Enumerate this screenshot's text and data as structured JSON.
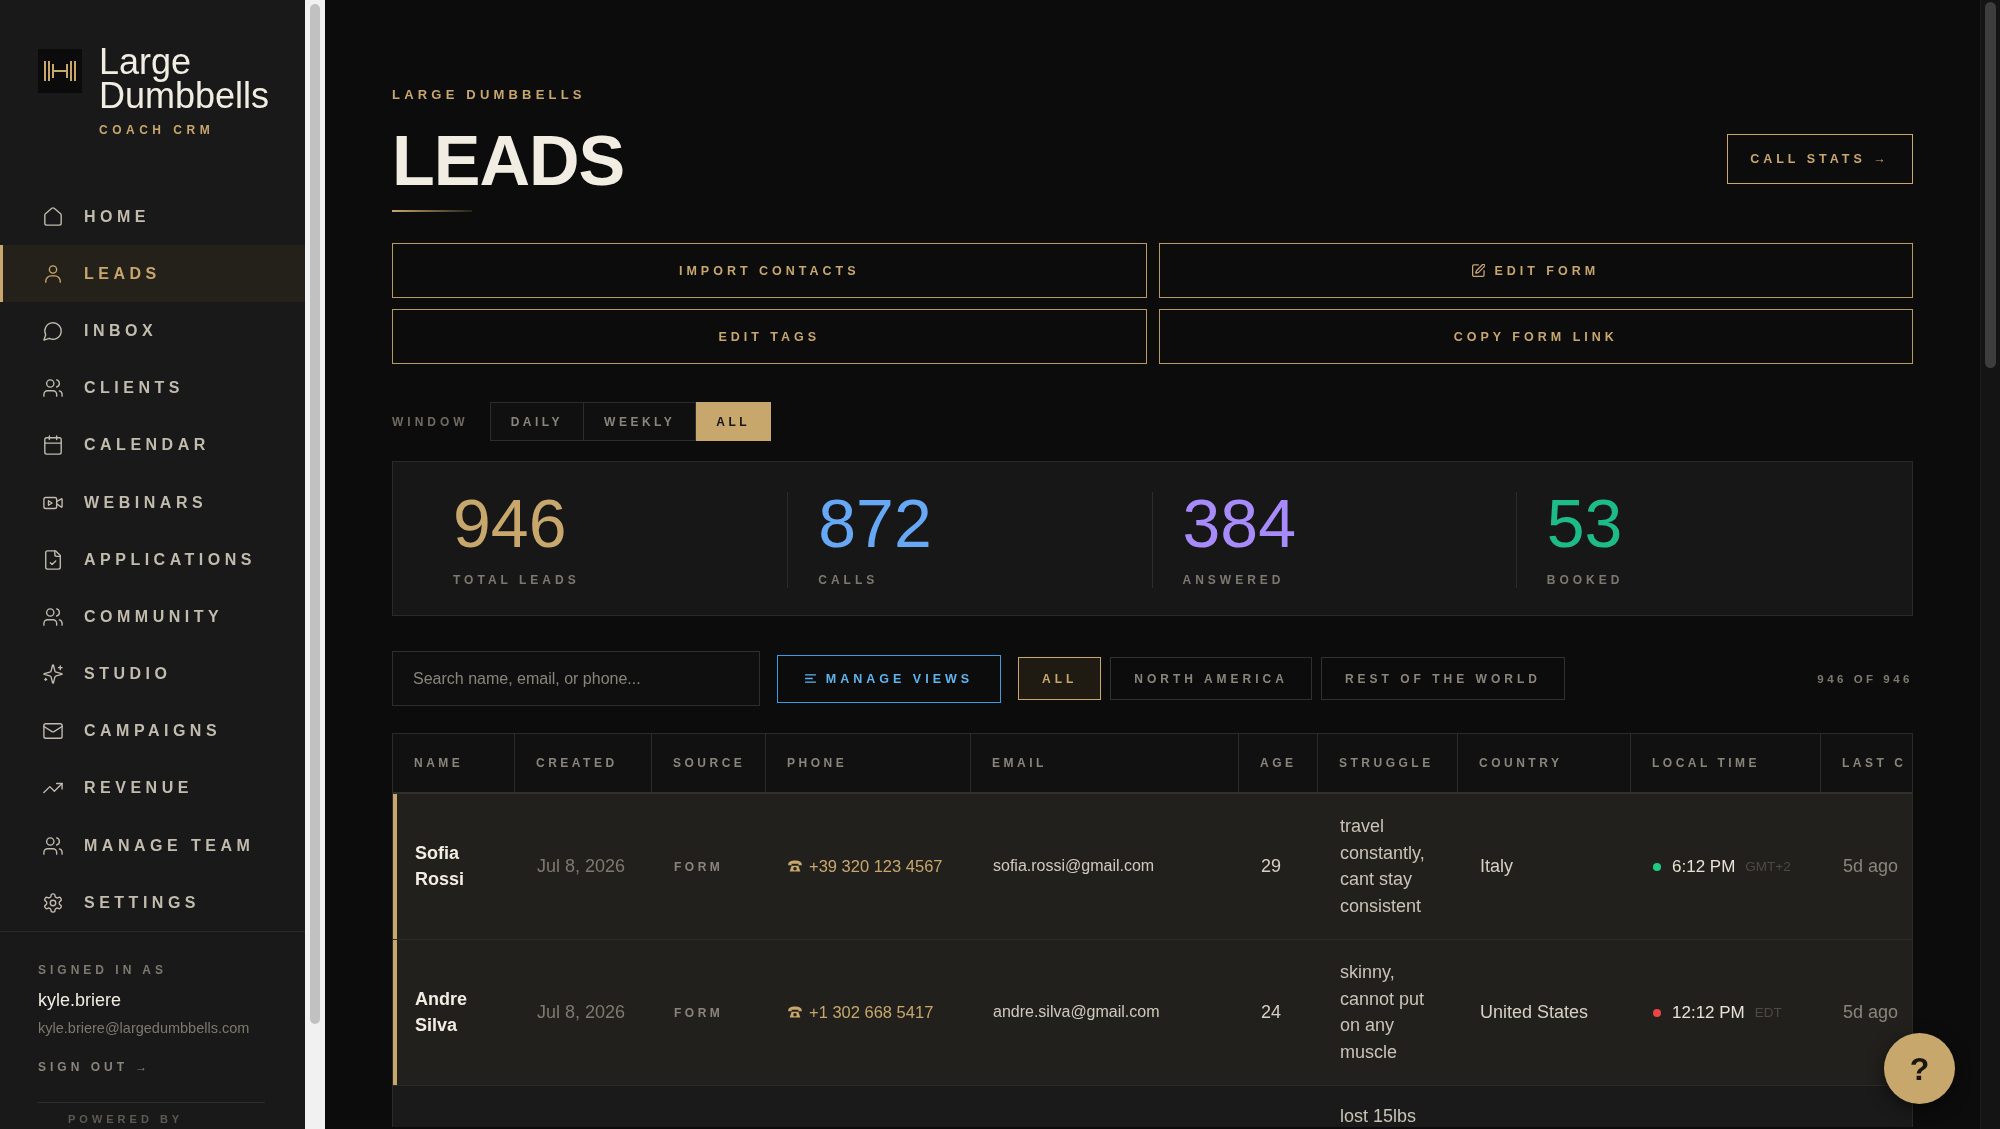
{
  "sidebar": {
    "brand": {
      "name": "Large Dumbbells",
      "tagline": "COACH CRM"
    },
    "nav": [
      {
        "label": "HOME",
        "selected": false
      },
      {
        "label": "LEADS",
        "selected": true
      },
      {
        "label": "INBOX",
        "selected": false
      },
      {
        "label": "CLIENTS",
        "selected": false
      },
      {
        "label": "CALENDAR",
        "selected": false
      },
      {
        "label": "WEBINARS",
        "selected": false
      },
      {
        "label": "APPLICATIONS",
        "selected": false
      },
      {
        "label": "COMMUNITY",
        "selected": false
      },
      {
        "label": "STUDIO",
        "selected": false
      },
      {
        "label": "CAMPAIGNS",
        "selected": false
      },
      {
        "label": "REVENUE",
        "selected": false
      },
      {
        "label": "MANAGE TEAM",
        "selected": false
      },
      {
        "label": "SETTINGS",
        "selected": false
      }
    ],
    "account": {
      "heading": "SIGNED IN AS",
      "username": "kyle.briere",
      "email": "kyle.briere@largedumbbells.com",
      "sign_out": "SIGN OUT →"
    },
    "footer": "POWERED BY"
  },
  "header": {
    "eyebrow": "LARGE DUMBBELLS",
    "title": "LEADS",
    "action": "CALL STATS →"
  },
  "actions": [
    {
      "label": "IMPORT CONTACTS",
      "kind": "plain"
    },
    {
      "label": "EDIT FORM",
      "kind": "icon"
    },
    {
      "label": "EDIT TAGS",
      "kind": "plain"
    },
    {
      "label": "COPY FORM LINK",
      "kind": "plain"
    }
  ],
  "window": {
    "label": "WINDOW",
    "options": [
      {
        "label": "DAILY",
        "selected": false
      },
      {
        "label": "WEEKLY",
        "selected": false
      },
      {
        "label": "ALL",
        "selected": true
      }
    ]
  },
  "stats": [
    {
      "value": "946",
      "label": "TOTAL LEADS",
      "color": "#c8a76c"
    },
    {
      "value": "872",
      "label": "CALLS",
      "color": "#66a8f5"
    },
    {
      "value": "384",
      "label": "ANSWERED",
      "color": "#a78bfa"
    },
    {
      "value": "53",
      "label": "BOOKED",
      "color": "#1dbb87"
    }
  ],
  "filters": {
    "search": {
      "placeholder": "Search name, email, or phone..."
    },
    "manage_views": "MANAGE VIEWS",
    "views": [
      {
        "label": "ALL",
        "selected": true
      },
      {
        "label": "NORTH AMERICA",
        "selected": false
      },
      {
        "label": "REST OF THE WORLD",
        "selected": false
      }
    ],
    "count": "946 OF 946"
  },
  "table": {
    "columns": [
      "NAME",
      "CREATED",
      "SOURCE",
      "PHONE",
      "EMAIL",
      "AGE",
      "STRUGGLE",
      "COUNTRY",
      "LOCAL TIME",
      "LAST C"
    ],
    "rows": [
      {
        "highlighted": true,
        "name": "Sofia Rossi",
        "created": "Jul 8, 2026",
        "source": "FORM",
        "phone": "+39 320 123 4567",
        "email": "sofia.rossi@gmail.com",
        "age": "29",
        "struggle": "travel constantly, cant stay consistent",
        "country": "Italy",
        "local_time": {
          "time": "6:12 PM",
          "zone": "GMT+2",
          "color": "#22c983"
        },
        "last_contact": "5d ago"
      },
      {
        "highlighted": true,
        "name": "Andre Silva",
        "created": "Jul 8, 2026",
        "source": "FORM",
        "phone": "+1 302 668 5417",
        "email": "andre.silva@gmail.com",
        "age": "24",
        "struggle": "skinny, cannot put on any muscle",
        "country": "United States",
        "local_time": {
          "time": "12:12 PM",
          "zone": "EDT",
          "color": "#ef4444"
        },
        "last_contact": "5d ago"
      },
      {
        "highlighted": false,
        "struggle": "lost 15lbs"
      }
    ]
  },
  "help_button": {
    "label": "?"
  }
}
